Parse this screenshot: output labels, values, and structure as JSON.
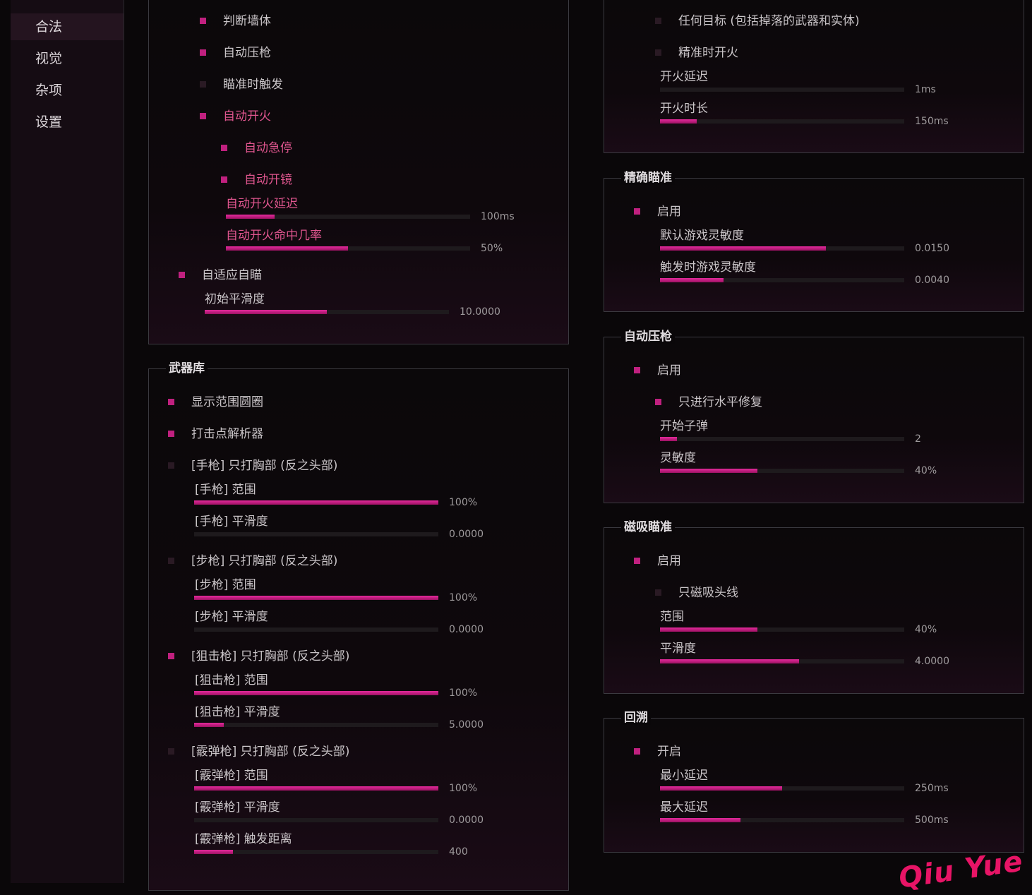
{
  "sidebar": {
    "items": [
      "合法",
      "视觉",
      "杂项",
      "设置"
    ],
    "active": 0
  },
  "colors": {
    "accent": "#c0207f",
    "active_label": "#e0568f",
    "background": "#0a0709"
  },
  "panel_top_left": {
    "rows": [
      {
        "type": "check",
        "label": "判断墙体",
        "checked": true
      },
      {
        "type": "check",
        "label": "自动压枪",
        "checked": true
      },
      {
        "type": "check",
        "label": "瞄准时触发",
        "checked": false
      },
      {
        "type": "check",
        "label": "自动开火",
        "checked": true,
        "highlight": true
      },
      {
        "type": "check",
        "label": "自动急停",
        "checked": true,
        "highlight": true
      },
      {
        "type": "check",
        "label": "自动开镜",
        "checked": true,
        "highlight": true
      },
      {
        "type": "slider",
        "label": "自动开火延迟",
        "value": "100ms",
        "level": 0.2,
        "highlight": true
      },
      {
        "type": "slider",
        "label": "自动开火命中几率",
        "value": "50%",
        "level": 0.5,
        "highlight": true
      },
      {
        "type": "check",
        "label": "自适应自瞄",
        "checked": true
      },
      {
        "type": "slider",
        "label": "初始平滑度",
        "value": "10.0000",
        "level": 0.5
      }
    ]
  },
  "panel_weapons": {
    "title": "武器库",
    "rows": [
      {
        "type": "check",
        "label": "显示范围圆圈",
        "checked": true
      },
      {
        "type": "check",
        "label": "打击点解析器",
        "checked": true
      },
      {
        "type": "check",
        "label": "[手枪] 只打胸部 (反之头部)",
        "checked": false
      },
      {
        "type": "slider",
        "label": "[手枪] 范围",
        "value": "100%",
        "level": 1.0
      },
      {
        "type": "slider",
        "label": "[手枪] 平滑度",
        "value": "0.0000",
        "level": 0.0
      },
      {
        "type": "check",
        "label": "[步枪] 只打胸部 (反之头部)",
        "checked": false
      },
      {
        "type": "slider",
        "label": "[步枪] 范围",
        "value": "100%",
        "level": 1.0
      },
      {
        "type": "slider",
        "label": "[步枪] 平滑度",
        "value": "0.0000",
        "level": 0.0
      },
      {
        "type": "check",
        "label": "[狙击枪] 只打胸部 (反之头部)",
        "checked": true
      },
      {
        "type": "slider",
        "label": "[狙击枪] 范围",
        "value": "100%",
        "level": 1.0
      },
      {
        "type": "slider",
        "label": "[狙击枪] 平滑度",
        "value": "5.0000",
        "level": 0.12
      },
      {
        "type": "check",
        "label": "[霰弹枪] 只打胸部 (反之头部)",
        "checked": false
      },
      {
        "type": "slider",
        "label": "[霰弹枪] 范围",
        "value": "100%",
        "level": 1.0
      },
      {
        "type": "slider",
        "label": "[霰弹枪] 平滑度",
        "value": "0.0000",
        "level": 0.0
      },
      {
        "type": "slider",
        "label": "[霰弹枪] 触发距离",
        "value": "400",
        "level": 0.16
      }
    ]
  },
  "panel_top_right": {
    "rows": [
      {
        "type": "check",
        "label": "任何目标 (包括掉落的武器和实体)",
        "checked": false
      },
      {
        "type": "check",
        "label": "精准时开火",
        "checked": false
      },
      {
        "type": "slider",
        "label": "开火延迟",
        "value": "1ms",
        "level": 0.0
      },
      {
        "type": "slider",
        "label": "开火时长",
        "value": "150ms",
        "level": 0.15
      }
    ]
  },
  "panel_precise": {
    "title": "精确瞄准",
    "rows": [
      {
        "type": "check",
        "label": "启用",
        "checked": true
      },
      {
        "type": "slider",
        "label": "默认游戏灵敏度",
        "value": "0.0150",
        "level": 0.68
      },
      {
        "type": "slider",
        "label": "触发时游戏灵敏度",
        "value": "0.0040",
        "level": 0.26
      }
    ]
  },
  "panel_recoil": {
    "title": "自动压枪",
    "rows": [
      {
        "type": "check",
        "label": "启用",
        "checked": true
      },
      {
        "type": "check",
        "label": "只进行水平修复",
        "checked": true
      },
      {
        "type": "slider",
        "label": "开始子弹",
        "value": "2",
        "level": 0.07
      },
      {
        "type": "slider",
        "label": "灵敏度",
        "value": "40%",
        "level": 0.4
      }
    ]
  },
  "panel_magnet": {
    "title": "磁吸瞄准",
    "rows": [
      {
        "type": "check",
        "label": "启用",
        "checked": true
      },
      {
        "type": "check",
        "label": "只磁吸头线",
        "checked": false
      },
      {
        "type": "slider",
        "label": "范围",
        "value": "40%",
        "level": 0.4
      },
      {
        "type": "slider",
        "label": "平滑度",
        "value": "4.0000",
        "level": 0.57
      }
    ]
  },
  "panel_backtrack": {
    "title": "回溯",
    "rows": [
      {
        "type": "check",
        "label": "开启",
        "checked": true
      },
      {
        "type": "slider",
        "label": "最小延迟",
        "value": "250ms",
        "level": 0.5
      },
      {
        "type": "slider",
        "label": "最大延迟",
        "value": "500ms",
        "level": 0.33
      }
    ]
  },
  "watermark": "Qiu Yue"
}
